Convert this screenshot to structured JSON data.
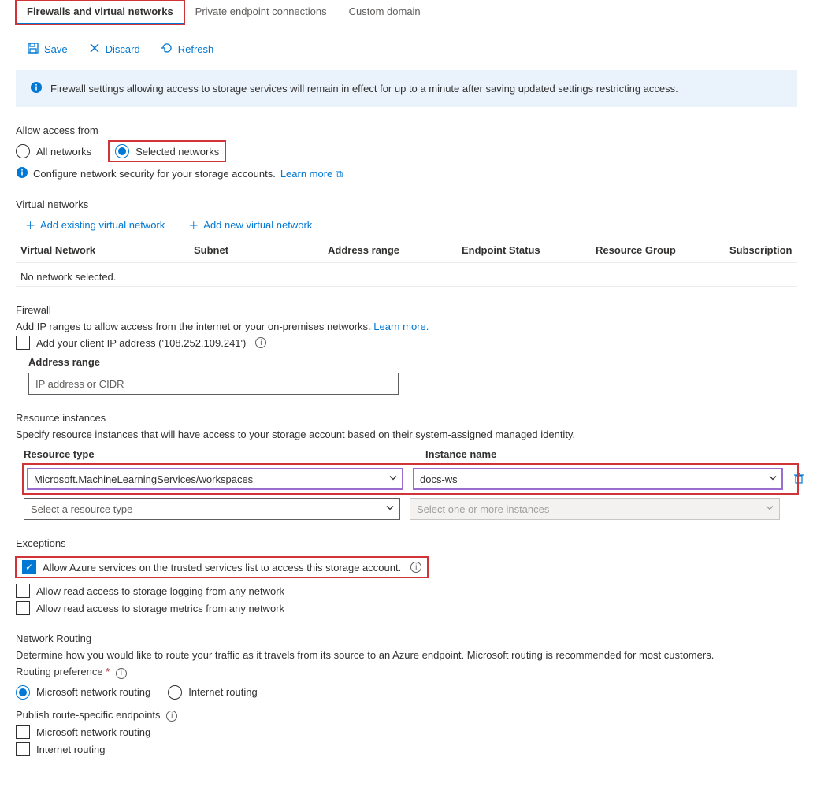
{
  "tabs": {
    "firewalls": "Firewalls and virtual networks",
    "private_ep": "Private endpoint connections",
    "custom_domain": "Custom domain"
  },
  "toolbar": {
    "save": "Save",
    "discard": "Discard",
    "refresh": "Refresh"
  },
  "banner": "Firewall settings allowing access to storage services will remain in effect for up to a minute after saving updated settings restricting access.",
  "access": {
    "label": "Allow access from",
    "all": "All networks",
    "selected": "Selected networks",
    "config_text": "Configure network security for your storage accounts.",
    "learn_more": "Learn more"
  },
  "vnets": {
    "title": "Virtual networks",
    "add_existing": "Add existing virtual network",
    "add_new": "Add new virtual network",
    "cols": {
      "vn": "Virtual Network",
      "subnet": "Subnet",
      "range": "Address range",
      "status": "Endpoint Status",
      "rg": "Resource Group",
      "sub": "Subscription"
    },
    "empty": "No network selected."
  },
  "firewall": {
    "title": "Firewall",
    "desc_a": "Add IP ranges to allow access from the internet or your on-premises networks.",
    "learn_more": "Learn more.",
    "add_client": "Add your client IP address ('108.252.109.241')",
    "range_label": "Address range",
    "range_placeholder": "IP address or CIDR"
  },
  "resinst": {
    "title": "Resource instances",
    "desc": "Specify resource instances that will have access to your storage account based on their system-assigned managed identity.",
    "col_type": "Resource type",
    "col_name": "Instance name",
    "row1_type": "Microsoft.MachineLearningServices/workspaces",
    "row1_name": "docs-ws",
    "placeholder_type": "Select a resource type",
    "placeholder_name": "Select one or more instances"
  },
  "exceptions": {
    "title": "Exceptions",
    "opt1": "Allow Azure services on the trusted services list to access this storage account.",
    "opt2": "Allow read access to storage logging from any network",
    "opt3": "Allow read access to storage metrics from any network"
  },
  "routing": {
    "title": "Network Routing",
    "desc": "Determine how you would like to route your traffic as it travels from its source to an Azure endpoint. Microsoft routing is recommended for most customers.",
    "pref_label": "Routing preference",
    "opt_ms": "Microsoft network routing",
    "opt_inet": "Internet routing",
    "publish_label": "Publish route-specific endpoints",
    "pub_ms": "Microsoft network routing",
    "pub_inet": "Internet routing"
  }
}
